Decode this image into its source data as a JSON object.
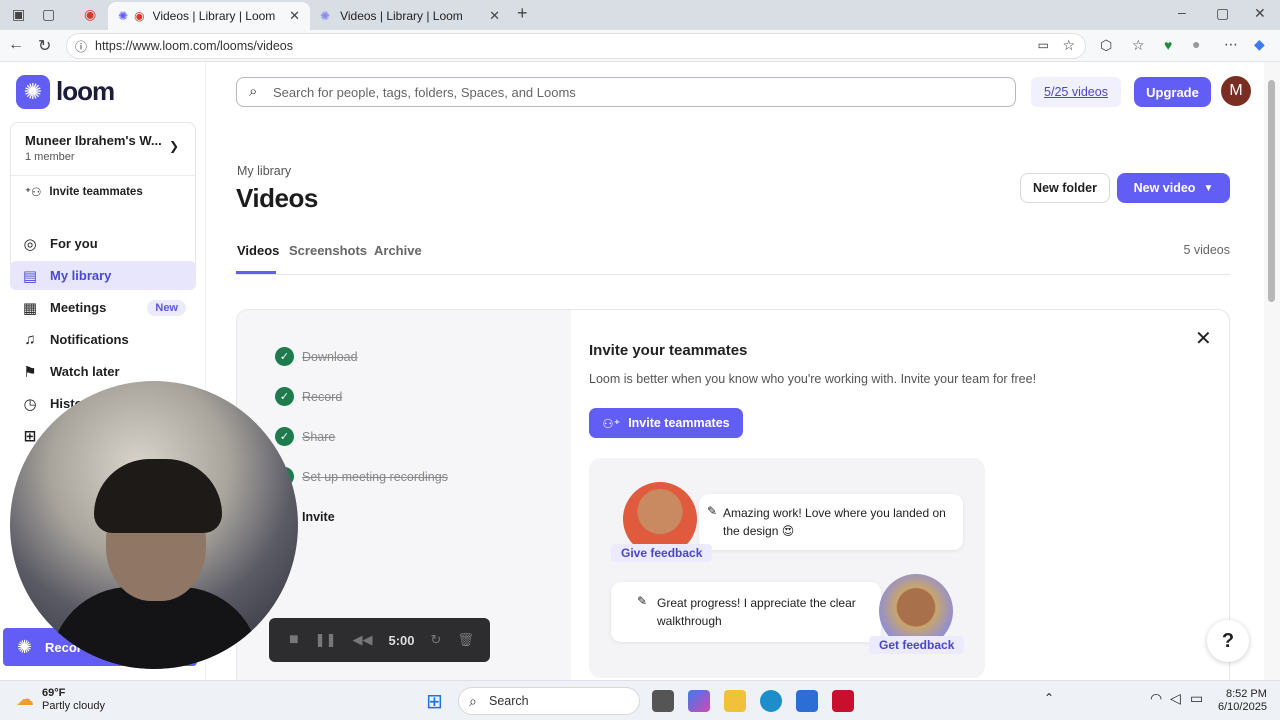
{
  "browser": {
    "tabs": [
      {
        "title": "Videos | Library | Loom",
        "active": true
      },
      {
        "title": "Videos | Library | Loom",
        "active": false
      }
    ],
    "url": "https://www.loom.com/looms/videos",
    "new_tab": "+",
    "close": "✕"
  },
  "sidebar": {
    "logo": "loom",
    "workspace": {
      "name": "Muneer Ibrahem's W...",
      "members": "1 member",
      "invite": "Invite teammates"
    },
    "items": [
      {
        "label": "For you",
        "icon": "user-circle-icon"
      },
      {
        "label": "My library",
        "icon": "library-icon",
        "active": true
      },
      {
        "label": "Meetings",
        "icon": "calendar-icon",
        "badge": "New"
      },
      {
        "label": "Notifications",
        "icon": "bell-icon"
      },
      {
        "label": "Watch later",
        "icon": "bookmark-icon"
      },
      {
        "label": "Histo",
        "icon": "clock-icon"
      }
    ],
    "record": "Recor"
  },
  "header": {
    "search_placeholder": "Search for people, tags, folders, Spaces, and Looms",
    "video_count": "5/25 videos",
    "upgrade": "Upgrade",
    "avatar": "M"
  },
  "page": {
    "breadcrumb": "My library",
    "title": "Videos",
    "new_folder": "New folder",
    "new_video": "New video",
    "tabs": [
      {
        "label": "Videos",
        "active": true
      },
      {
        "label": "Screenshots"
      },
      {
        "label": "Archive"
      }
    ],
    "count": "5 videos"
  },
  "onboarding": {
    "steps": [
      {
        "label": "Download",
        "done": true
      },
      {
        "label": "Record",
        "done": true
      },
      {
        "label": "Share",
        "done": true
      },
      {
        "label": "Set up meeting recordings",
        "done": true
      },
      {
        "label": "Invite",
        "done": false
      }
    ],
    "title": "Invite your teammates",
    "subtitle": "Loom is better when you know who you're working with. Invite your team for free!",
    "button": "Invite teammates",
    "comment1": "Amazing work! Love where you landed on the design 😍",
    "tag1": "Give feedback",
    "comment2": "Great progress! I appreciate the clear walkthrough",
    "tag2": "Get feedback"
  },
  "recorder": {
    "time": "5:00"
  },
  "help": "?",
  "taskbar": {
    "temp": "69°F",
    "weather": "Partly cloudy",
    "search": "Search",
    "time": "8:52 PM",
    "date": "6/10/2025"
  },
  "colors": {
    "accent": "#625df5",
    "check": "#1f7a4d"
  }
}
